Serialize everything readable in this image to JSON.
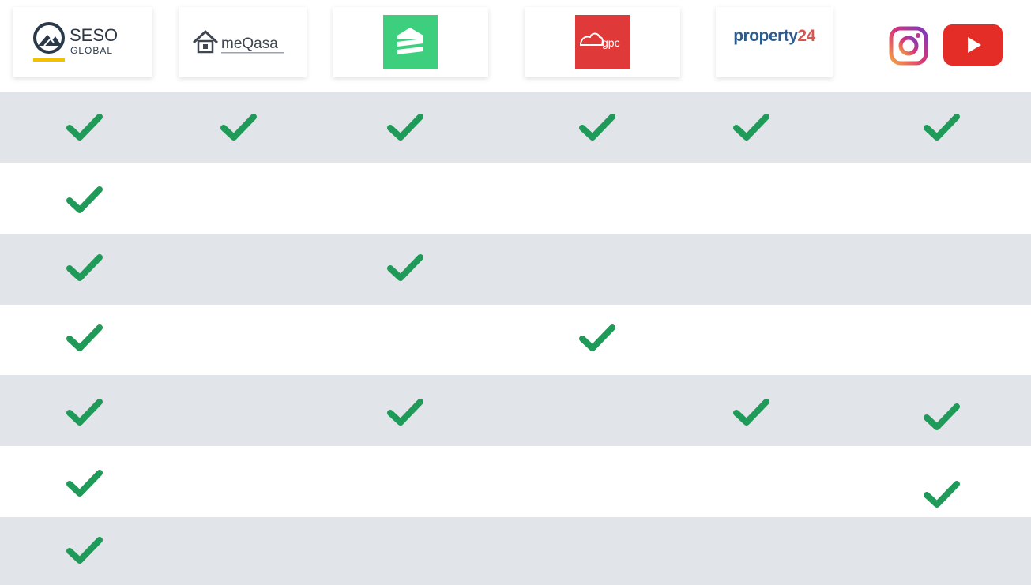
{
  "brands": [
    {
      "key": "seso",
      "name_line1": "SESO",
      "name_line2": "GLOBAL",
      "accent": "#f2c200",
      "text_color": "#2b3a4a"
    },
    {
      "key": "meqasa",
      "name": "meQasa",
      "text_color": "#3f4650"
    },
    {
      "key": "green",
      "color": "#3ecf7e"
    },
    {
      "key": "gpc",
      "name": "gpc",
      "color": "#e0393a"
    },
    {
      "key": "property24",
      "name_main": "property",
      "name_num": "24",
      "main_color": "#2c5c8f",
      "num_color": "#d9534f"
    },
    {
      "key": "social",
      "icons": [
        "instagram-icon",
        "youtube-icon"
      ],
      "youtube_color": "#e52d27"
    }
  ],
  "colors": {
    "check": "#1f9a58",
    "row_shaded": "#e1e4e9",
    "row_plain": "#ffffff"
  },
  "matrix": [
    [
      true,
      true,
      true,
      true,
      true,
      true
    ],
    [
      true,
      false,
      false,
      false,
      false,
      false
    ],
    [
      true,
      false,
      true,
      false,
      false,
      false
    ],
    [
      true,
      false,
      false,
      true,
      false,
      false
    ],
    [
      true,
      false,
      true,
      false,
      true,
      true
    ],
    [
      true,
      false,
      false,
      false,
      false,
      true
    ],
    [
      true,
      false,
      false,
      false,
      false,
      false
    ]
  ]
}
